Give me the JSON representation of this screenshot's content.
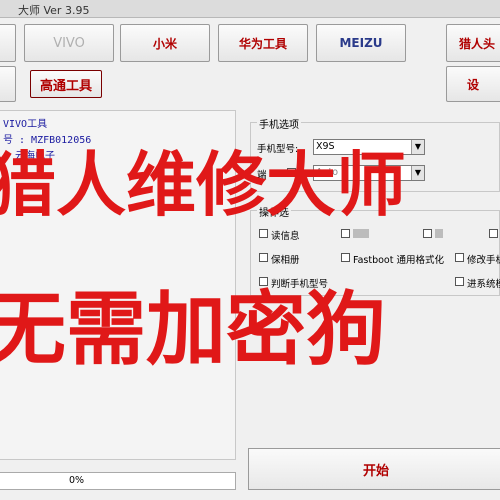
{
  "window": {
    "title": "大师 Ver 3.95"
  },
  "toolbar": {
    "row1": [
      "VIVO",
      "小米",
      "华为工具",
      "MEIZU",
      "猎人头"
    ],
    "row2": [
      "高通工具",
      "设"
    ]
  },
  "left_panel": {
    "lines": [
      "VIVO工具",
      "号 : MZFB012056",
      "  : 云海电子"
    ]
  },
  "right_panel": {
    "group1_title": "手机选项",
    "model_label": "手机型号:",
    "model_value": "X9S",
    "port_label": "端",
    "port_value": "Auto",
    "group2_title": "操作选",
    "options": [
      "读信息",
      "Fastboot 通用格式化",
      "修改手机",
      "保相册",
      "判断手机型号",
      "进系统模"
    ]
  },
  "progress": {
    "value": "0%"
  },
  "actions": {
    "start": "开始"
  },
  "overlay": {
    "line1": "猎人维修大师",
    "line2": "无需加密狗"
  },
  "colors": {
    "overlay_red": "#e01818",
    "button_red": "#b00000",
    "info_blue": "#1a1aa0"
  }
}
